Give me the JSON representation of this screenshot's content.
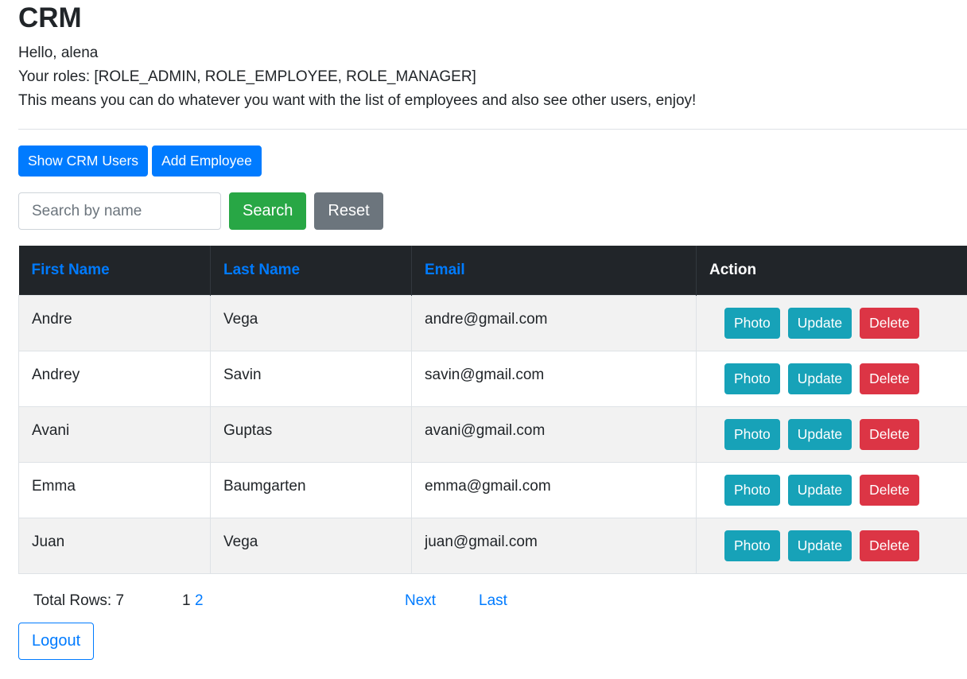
{
  "header": {
    "title": "CRM",
    "greeting": "Hello, alena",
    "roles": "Your roles: [ROLE_ADMIN, ROLE_EMPLOYEE, ROLE_MANAGER]",
    "message": "This means you can do whatever you want with the list of employees and also see other users, enjoy!"
  },
  "toolbar": {
    "show_users_label": "Show CRM Users",
    "add_employee_label": "Add Employee"
  },
  "search": {
    "placeholder": "Search by name",
    "value": "",
    "search_label": "Search",
    "reset_label": "Reset"
  },
  "table": {
    "columns": [
      {
        "label": "First Name",
        "sortable": true
      },
      {
        "label": "Last Name",
        "sortable": true
      },
      {
        "label": "Email",
        "sortable": true
      },
      {
        "label": "Action",
        "sortable": false
      }
    ],
    "action_labels": {
      "photo": "Photo",
      "update": "Update",
      "delete": "Delete"
    },
    "rows": [
      {
        "first_name": "Andre",
        "last_name": "Vega",
        "email": "andre@gmail.com"
      },
      {
        "first_name": "Andrey",
        "last_name": "Savin",
        "email": "savin@gmail.com"
      },
      {
        "first_name": "Avani",
        "last_name": "Guptas",
        "email": "avani@gmail.com"
      },
      {
        "first_name": "Emma",
        "last_name": "Baumgarten",
        "email": "emma@gmail.com"
      },
      {
        "first_name": "Juan",
        "last_name": "Vega",
        "email": "juan@gmail.com"
      }
    ]
  },
  "pagination": {
    "total_rows": "Total Rows: 7",
    "current_page": "1",
    "page_2": "2",
    "next_label": "Next",
    "last_label": "Last"
  },
  "footer": {
    "logout_label": "Logout"
  },
  "colors": {
    "primary": "#007bff",
    "success": "#28a745",
    "secondary": "#6c757d",
    "info": "#17a2b8",
    "danger": "#dc3545",
    "table_header": "#212529"
  }
}
